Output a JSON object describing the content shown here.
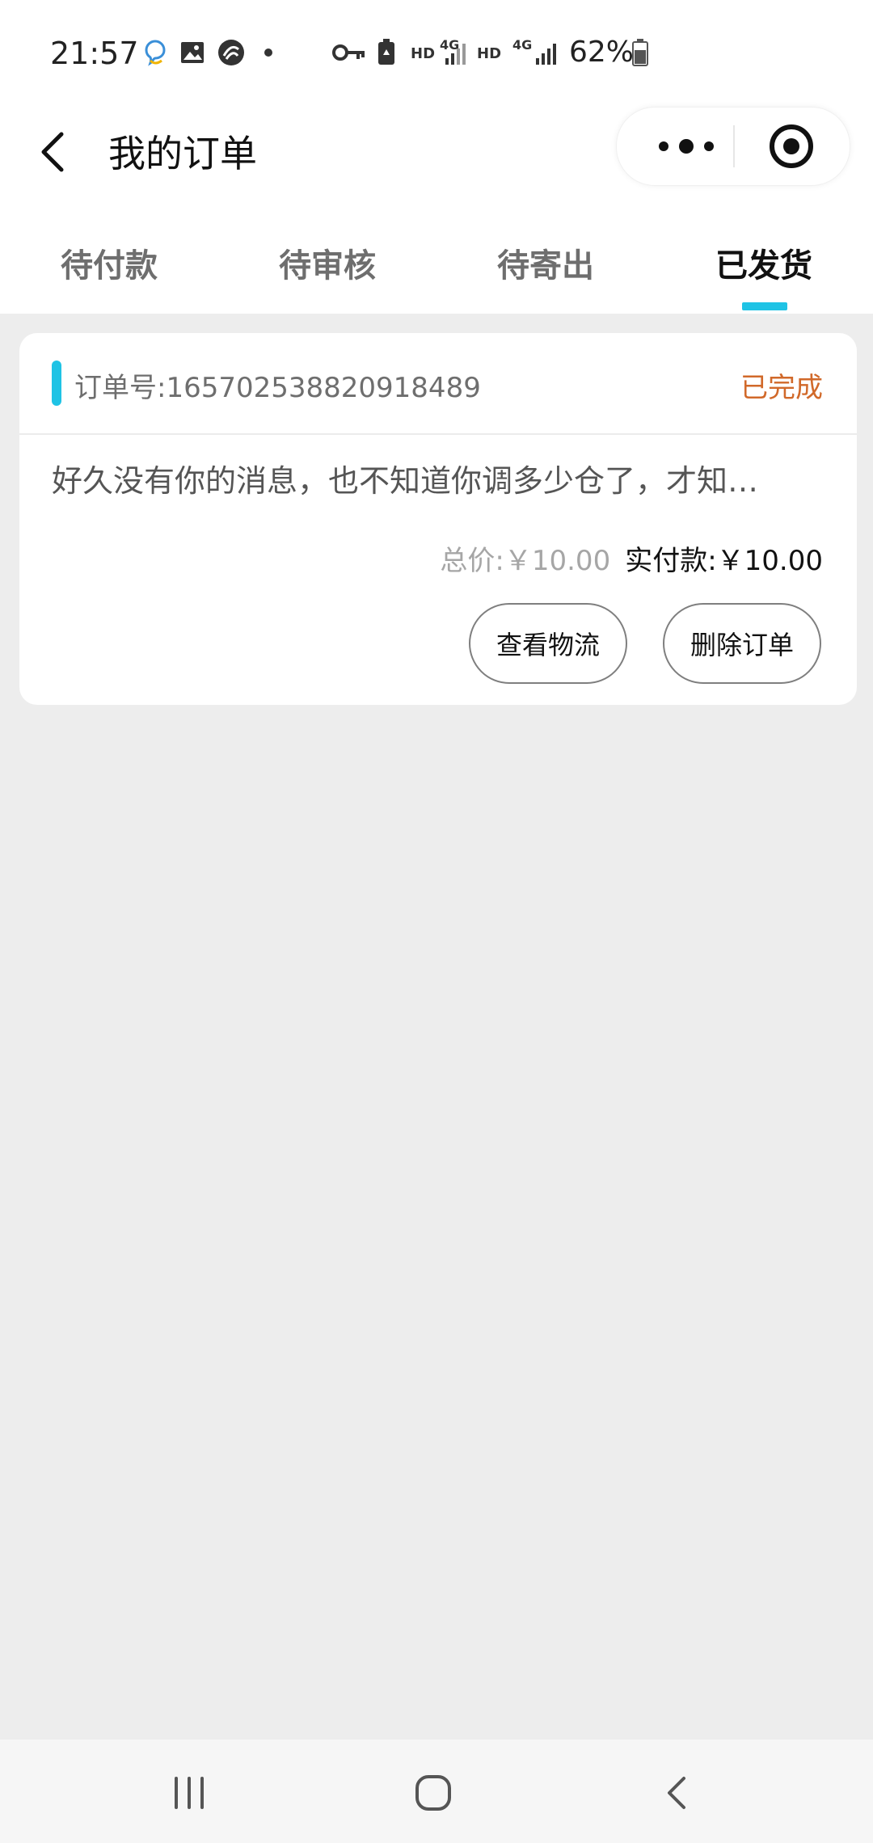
{
  "status_bar": {
    "time": "21:57",
    "battery_percent": "62%",
    "hd1": "HD",
    "net1": "4G",
    "hd2": "HD",
    "net2": "4G",
    "icons": [
      "assistant-icon",
      "gallery-icon",
      "app-notification-icon",
      "dot-icon",
      "vpn-key-icon",
      "battery-saver-icon",
      "signal-icon",
      "signal-icon-2",
      "battery-icon"
    ]
  },
  "nav": {
    "title": "我的订单",
    "back_icon": "chevron-left-icon",
    "more_icon": "more-dots-icon",
    "close_icon": "target-circle-icon"
  },
  "tabs": [
    {
      "label": "待付款",
      "active": false
    },
    {
      "label": "待审核",
      "active": false
    },
    {
      "label": "待寄出",
      "active": false
    },
    {
      "label": "已发货",
      "active": true
    }
  ],
  "order": {
    "number_label": "订单号:165702538820918489",
    "status": "已完成",
    "description": "好久没有你的消息，也不知道你调多少仓了，才知…",
    "total_label": "总价:￥10.00",
    "paid_label": "实付款:￥10.00",
    "buttons": {
      "logistics": "查看物流",
      "delete": "删除订单"
    }
  },
  "colors": {
    "accent": "#1fc3e5",
    "status_orange": "#d1692a",
    "page_bg": "#ededed"
  },
  "system_nav": {
    "recents_icon": "recents-icon",
    "home_icon": "home-icon",
    "back_icon": "back-icon"
  }
}
